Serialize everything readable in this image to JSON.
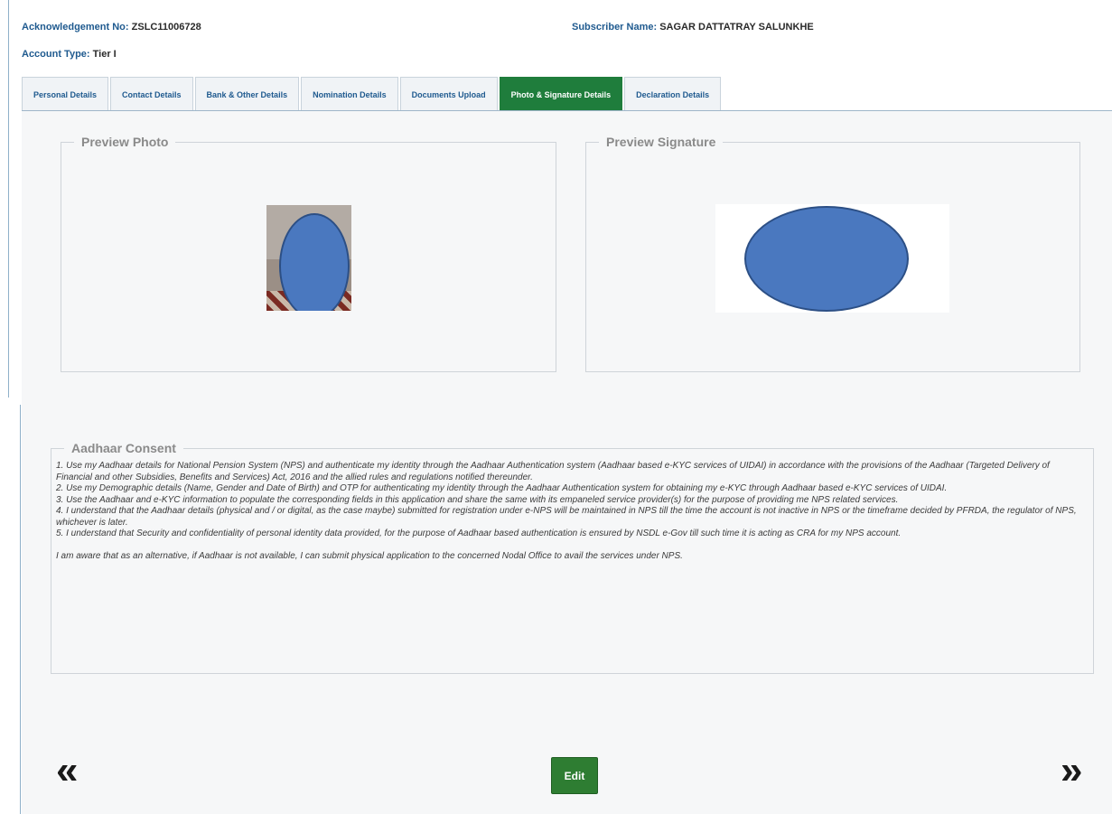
{
  "header": {
    "acknowledgement_label": "Acknowledgement No:",
    "acknowledgement_value": "ZSLC11006728",
    "subscriber_label": "Subscriber Name:",
    "subscriber_value": "SAGAR DATTATRAY SALUNKHE",
    "account_type_label": "Account Type:",
    "account_type_value": "Tier I"
  },
  "tabs": [
    {
      "label": "Personal Details",
      "active": false
    },
    {
      "label": "Contact Details",
      "active": false
    },
    {
      "label": "Bank & Other Details",
      "active": false
    },
    {
      "label": "Nomination Details",
      "active": false
    },
    {
      "label": "Documents Upload",
      "active": false
    },
    {
      "label": "Photo & Signature Details",
      "active": true
    },
    {
      "label": "Declaration Details",
      "active": false
    }
  ],
  "preview_photo": {
    "legend": "Preview Photo"
  },
  "preview_signature": {
    "legend": "Preview Signature"
  },
  "consent": {
    "legend": "Aadhaar Consent",
    "items": [
      "1. Use my Aadhaar details for National Pension System (NPS) and authenticate my identity through the Aadhaar Authentication system (Aadhaar based e-KYC services of UIDAI) in accordance with the provisions of the Aadhaar (Targeted Delivery of Financial and other Subsidies, Benefits and Services) Act, 2016 and the allied rules and regulations notified thereunder.",
      "2. Use my Demographic details (Name, Gender and Date of Birth) and OTP for authenticating my identity through the Aadhaar Authentication system for obtaining my e-KYC through Aadhaar based e-KYC services of UIDAI.",
      "3. Use the Aadhaar and e-KYC information to populate the corresponding fields in this application and share the same with its empaneled service provider(s) for the purpose of providing me NPS related services.",
      "4. I understand that the Aadhaar details (physical and / or digital, as the case maybe) submitted for registration under e-NPS will be maintained in NPS till the time the account is not inactive in NPS or the timeframe decided by PFRDA, the regulator of NPS, whichever is later.",
      "5. I understand that Security and confidentiality of personal identity data provided, for the purpose of Aadhaar based authentication is ensured by NSDL e-Gov till such time it is acting as CRA for my NPS account."
    ],
    "closing": "I am aware that as an alternative, if Aadhaar is not available, I can submit physical application to the concerned Nodal Office to avail the services under NPS."
  },
  "nav": {
    "prev": "«",
    "next": "»"
  },
  "edit_label": "Edit",
  "colors": {
    "accent_green": "#2e7d32",
    "active_tab": "#1f7d3c",
    "label_blue": "#1f5a8f",
    "redaction_blue": "#4a78bf"
  }
}
